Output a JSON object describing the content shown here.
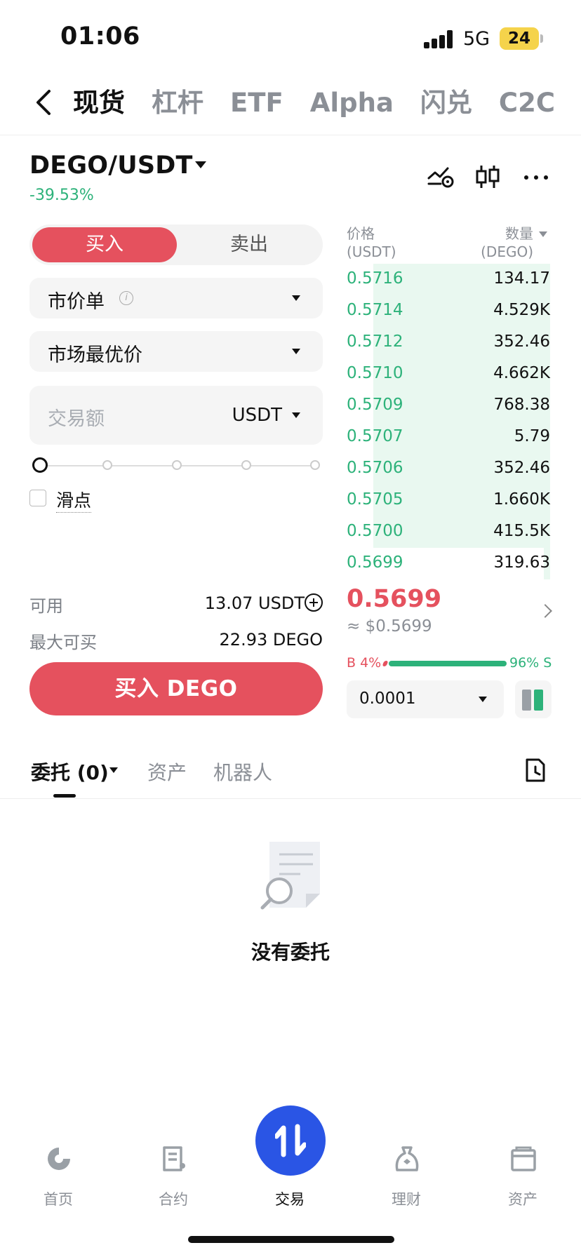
{
  "status_bar": {
    "time": "01:06",
    "network": "5G",
    "battery": "24"
  },
  "top_tabs": [
    {
      "label": "现货",
      "active": true
    },
    {
      "label": "杠杆",
      "active": false
    },
    {
      "label": "ETF",
      "active": false
    },
    {
      "label": "Alpha",
      "active": false
    },
    {
      "label": "闪兑",
      "active": false
    },
    {
      "label": "C2C",
      "active": false
    }
  ],
  "pair": {
    "name": "DEGO/USDT",
    "change": "-39.53%"
  },
  "order_form": {
    "buy_label": "买入",
    "sell_label": "卖出",
    "order_type": "市价单",
    "price_mode": "市场最优价",
    "amount_placeholder": "交易额",
    "amount_unit": "USDT",
    "slippage_label": "滑点",
    "available_label": "可用",
    "available_value": "13.07 USDT",
    "max_buy_label": "最大可买",
    "max_buy_value": "22.93 DEGO",
    "submit_label": "买入 DEGO"
  },
  "order_book": {
    "price_header": "价格",
    "price_unit": "(USDT)",
    "qty_header": "数量",
    "qty_unit": "(DEGO)",
    "rows": [
      {
        "price": "0.5716",
        "qty": "134.17",
        "depth": 0.87
      },
      {
        "price": "0.5714",
        "qty": "4.529K",
        "depth": 0.87
      },
      {
        "price": "0.5712",
        "qty": "352.46",
        "depth": 0.87
      },
      {
        "price": "0.5710",
        "qty": "4.662K",
        "depth": 0.87
      },
      {
        "price": "0.5709",
        "qty": "768.38",
        "depth": 0.87
      },
      {
        "price": "0.5707",
        "qty": "5.79",
        "depth": 0.87
      },
      {
        "price": "0.5706",
        "qty": "352.46",
        "depth": 0.87
      },
      {
        "price": "0.5705",
        "qty": "1.660K",
        "depth": 0.87
      },
      {
        "price": "0.5700",
        "qty": "415.5K",
        "depth": 0.87
      },
      {
        "price": "0.5699",
        "qty": "319.63",
        "depth": 0.03
      }
    ],
    "last_price": "0.5699",
    "last_price_usd": "≈ $0.5699",
    "buy_ratio_label": "B 4%",
    "sell_ratio_label": "96% S",
    "buy_ratio": 0.04,
    "precision": "0.0001"
  },
  "bottom_tabs": [
    {
      "label": "委托 (0)",
      "active": true
    },
    {
      "label": "资产",
      "active": false
    },
    {
      "label": "机器人",
      "active": false
    }
  ],
  "empty_state": {
    "title": "没有委托"
  },
  "nav": [
    {
      "label": "首页",
      "icon": "home-icon"
    },
    {
      "label": "合约",
      "icon": "futures-icon"
    },
    {
      "label": "交易",
      "icon": "trade-icon"
    },
    {
      "label": "理财",
      "icon": "earn-icon"
    },
    {
      "label": "资产",
      "icon": "wallet-icon"
    }
  ],
  "colors": {
    "buy": "#e5515e",
    "sell": "#2db27a",
    "accent": "#2a55e5"
  }
}
